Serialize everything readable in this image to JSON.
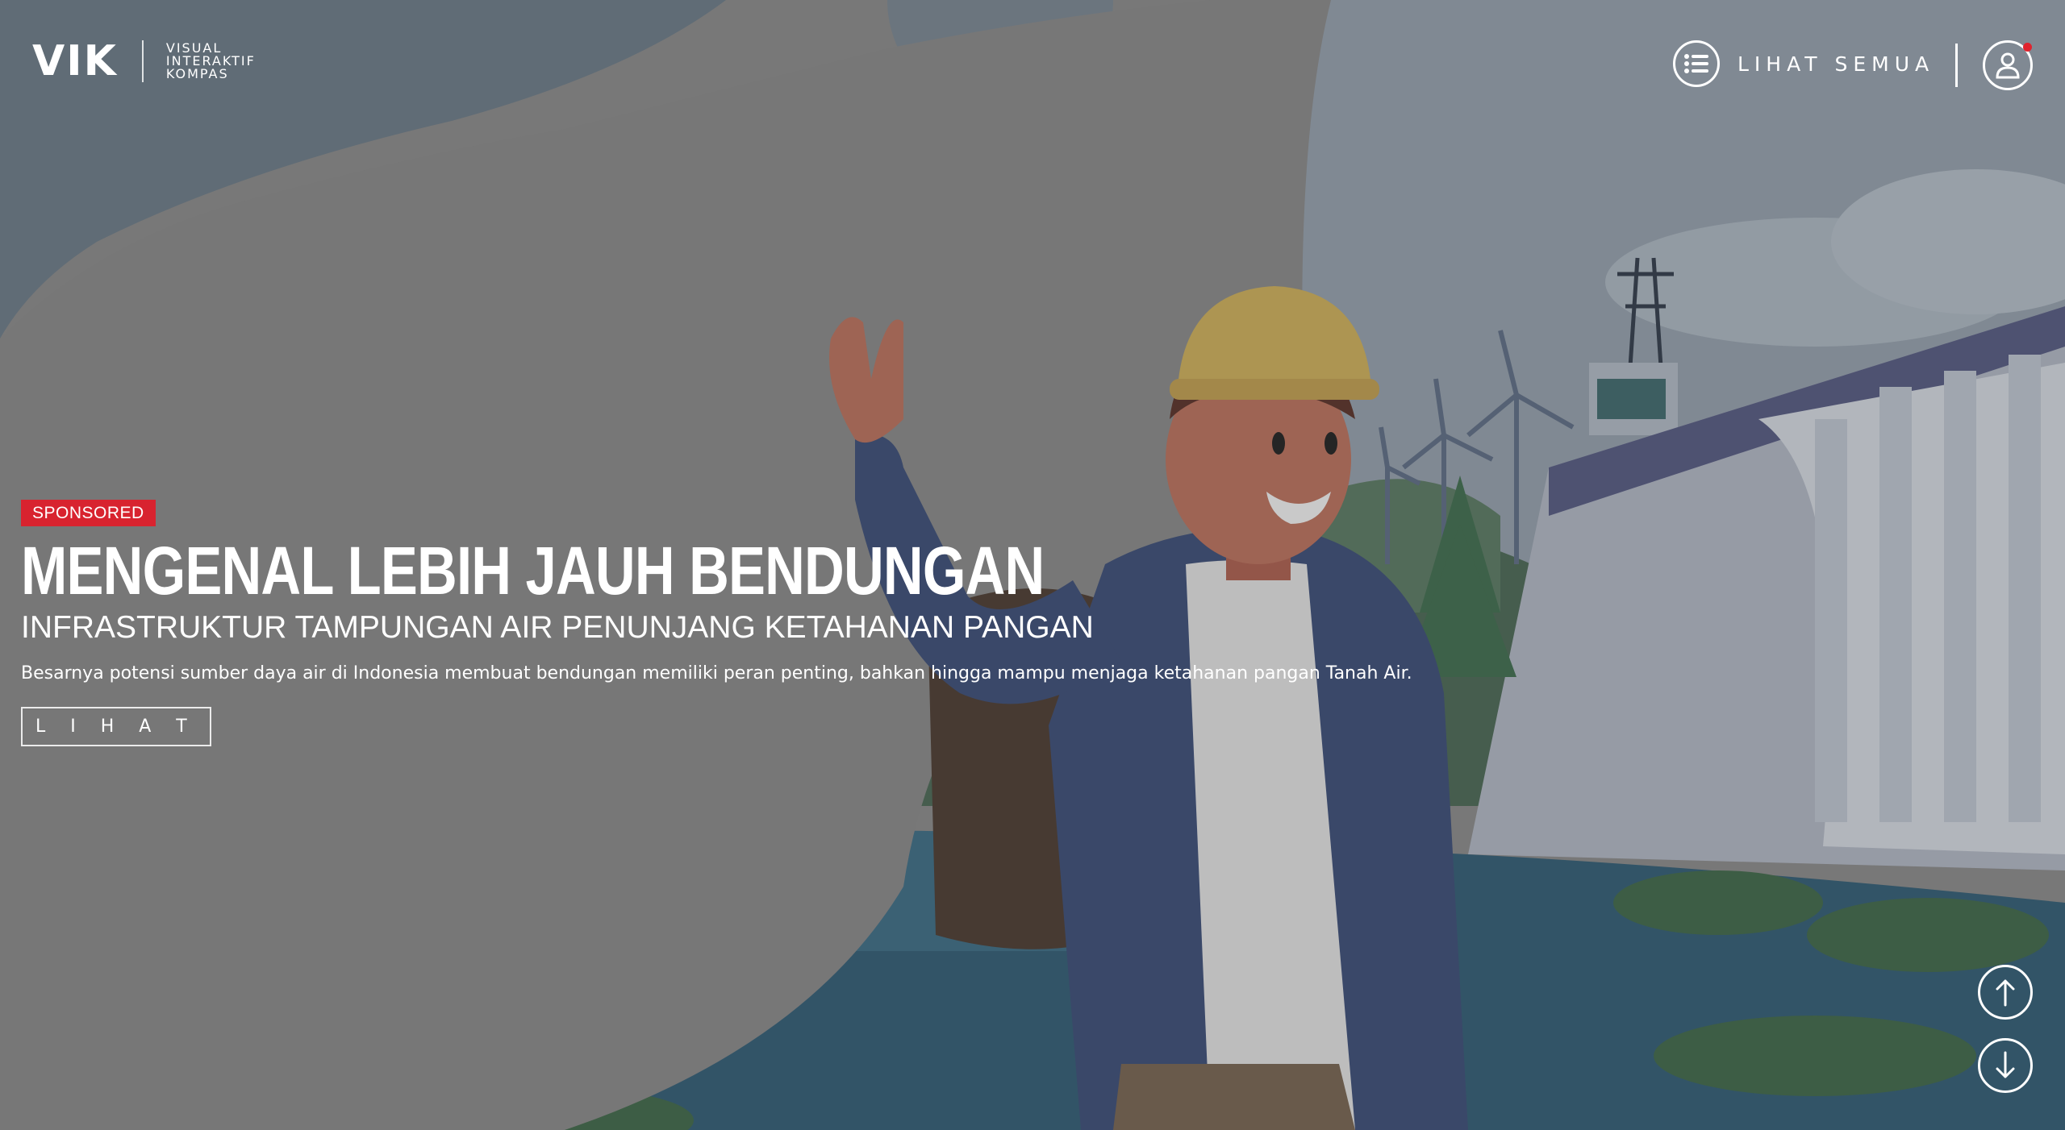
{
  "header": {
    "logo_mark": "VIK",
    "logo_sub": [
      "VISUAL",
      "INTERAKTIF",
      "KOMPAS"
    ],
    "nav_all_label": "LIHAT SEMUA"
  },
  "hero": {
    "badge": "SPONSORED",
    "title": "MENGENAL LEBIH JAUH BENDUNGAN",
    "subtitle": "INFRASTRUKTUR TAMPUNGAN AIR PENUNJANG KETAHANAN PANGAN",
    "description": "Besarnya potensi sumber daya air di Indonesia membuat bendungan memiliki peran penting, bahkan hingga mampu menjaga ketahanan pangan Tanah Air.",
    "cta_label": "L I H A T"
  },
  "colors": {
    "badge": "#d8232f",
    "notification": "#e0232e",
    "overlay": "#7c7c7c"
  },
  "icons": {
    "menu": "list-icon",
    "user": "user-icon",
    "up": "arrow-up-icon",
    "down": "arrow-down-icon"
  }
}
